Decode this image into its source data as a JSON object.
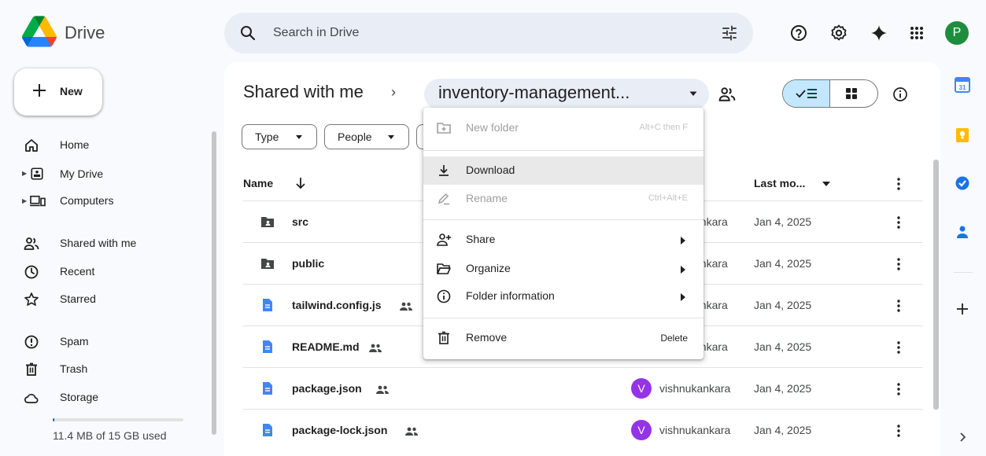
{
  "app": {
    "name": "Drive"
  },
  "search": {
    "placeholder": "Search in Drive"
  },
  "user": {
    "initial": "P"
  },
  "sidebar": {
    "new_label": "New",
    "items": [
      {
        "label": "Home"
      },
      {
        "label": "My Drive"
      },
      {
        "label": "Computers"
      },
      {
        "label": "Shared with me"
      },
      {
        "label": "Recent"
      },
      {
        "label": "Starred"
      },
      {
        "label": "Spam"
      },
      {
        "label": "Trash"
      },
      {
        "label": "Storage"
      }
    ],
    "storage_text": "11.4 MB of 15 GB used",
    "storage_fraction": 0.01
  },
  "breadcrumb": {
    "root": "Shared with me",
    "separator": "›",
    "folder": "inventory-management..."
  },
  "filters": [
    {
      "label": "Type"
    },
    {
      "label": "People"
    }
  ],
  "table": {
    "headers": {
      "name": "Name",
      "last_modified": "Last mo..."
    },
    "rows": [
      {
        "name": "src",
        "type": "shared-folder",
        "owner": "ankara",
        "date": "Jan 4, 2025"
      },
      {
        "name": "public",
        "type": "shared-folder",
        "owner": "ankara",
        "date": "Jan 4, 2025"
      },
      {
        "name": "tailwind.config.js",
        "type": "doc",
        "owner": "ankara",
        "date": "Jan 4, 2025"
      },
      {
        "name": "README.md",
        "type": "doc",
        "owner": "ankara",
        "date": "Jan 4, 2025"
      },
      {
        "name": "package.json",
        "type": "doc",
        "owner": "vishnukankara",
        "owner_initial": "V",
        "date": "Jan 4, 2025"
      },
      {
        "name": "package-lock.json",
        "type": "doc",
        "owner": "vishnukankara",
        "owner_initial": "V",
        "date": "Jan 4, 2025"
      }
    ]
  },
  "context_menu": {
    "new_folder": {
      "label": "New folder",
      "shortcut": "Alt+C then F"
    },
    "download": {
      "label": "Download"
    },
    "rename": {
      "label": "Rename",
      "shortcut": "Ctrl+Alt+E"
    },
    "share": {
      "label": "Share"
    },
    "organize": {
      "label": "Organize"
    },
    "folder_info": {
      "label": "Folder information"
    },
    "remove": {
      "label": "Remove",
      "shortcut": "Delete"
    }
  },
  "colors": {
    "accent_blue": "#0b57d0",
    "selected_view": "#c2e7ff",
    "doc_blue": "#4285f4",
    "owner_avatar": "#9334e6",
    "user_avatar": "#1e8e3e"
  }
}
